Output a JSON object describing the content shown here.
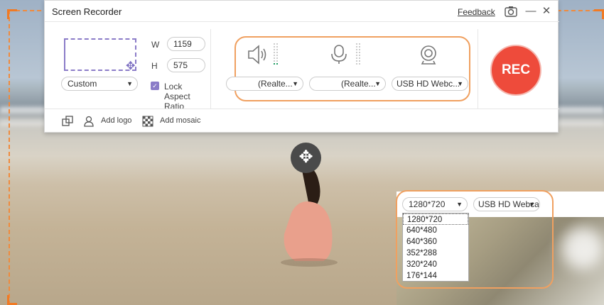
{
  "window": {
    "title": "Screen Recorder",
    "feedback": "Feedback"
  },
  "region": {
    "width_label": "W",
    "width_value": "1159",
    "height_label": "H",
    "height_value": "575",
    "preset": "Custom",
    "lock_aspect": "Lock Aspect Ratio",
    "lock_checked": true
  },
  "audio": {
    "speaker_device": "(Realte...",
    "mic_device": "(Realte...",
    "webcam_device": "USB HD Webc..."
  },
  "rec_button": "REC",
  "bottom": {
    "add_logo": "Add logo",
    "add_mosaic": "Add mosaic"
  },
  "webcam": {
    "resolution": "1280*720",
    "device": "USB HD Webca",
    "resolution_options": [
      "1280*720",
      "640*480",
      "640*360",
      "352*288",
      "320*240",
      "176*144"
    ]
  },
  "colors": {
    "accent": "#8b7cc8",
    "rec": "#ee4b3b",
    "capture_border": "#f08a3c"
  },
  "icons": [
    "settings-camera-icon",
    "minimize-icon",
    "close-icon",
    "move-icon",
    "speaker-icon",
    "microphone-icon",
    "webcam-icon",
    "crop-icon",
    "person-icon",
    "mosaic-icon"
  ]
}
